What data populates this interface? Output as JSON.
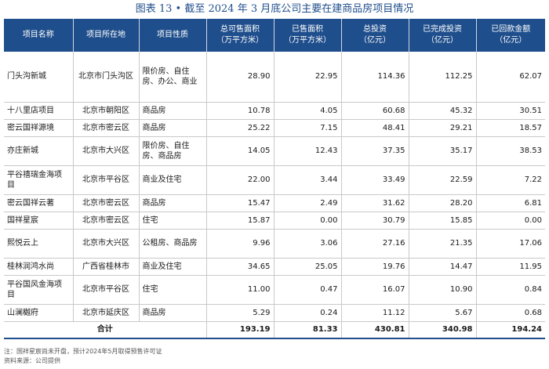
{
  "title": "图表 13 • 截至 2024 年 3 月底公司主要在建商品房项目情况",
  "headers": {
    "name": "项目名称",
    "location": "项目所在地",
    "nature": "项目性质",
    "saleable_area": "总可售面积\n（万平方米）",
    "sold_area": "已售面积\n（万平方米）",
    "total_investment": "总投资\n（亿元）",
    "completed_investment": "已完成投资\n（亿元）",
    "collected": "已回款金额\n（亿元）"
  },
  "rows": [
    {
      "name": "门头沟新城",
      "location": "北京市门头沟区",
      "nature": "限价房、自住房、办公、商业",
      "saleable_area": "28.90",
      "sold_area": "22.95",
      "total_investment": "114.36",
      "completed_investment": "112.25",
      "collected": "62.07"
    },
    {
      "name": "十八里店项目",
      "location": "北京市朝阳区",
      "nature": "商品房",
      "saleable_area": "10.78",
      "sold_area": "4.05",
      "total_investment": "60.68",
      "completed_investment": "45.32",
      "collected": "30.51"
    },
    {
      "name": "密云国祥源境",
      "location": "北京市密云区",
      "nature": "商品房",
      "saleable_area": "25.22",
      "sold_area": "7.15",
      "total_investment": "48.41",
      "completed_investment": "29.21",
      "collected": "18.57"
    },
    {
      "name": "亦庄新城",
      "location": "北京市大兴区",
      "nature": "限价房、自住房、商品房",
      "saleable_area": "14.05",
      "sold_area": "12.43",
      "total_investment": "37.35",
      "completed_investment": "35.17",
      "collected": "38.53"
    },
    {
      "name": "平谷禧瑞金海项目",
      "location": "北京市平谷区",
      "nature": "商业及住宅",
      "saleable_area": "22.00",
      "sold_area": "3.44",
      "total_investment": "33.49",
      "completed_investment": "22.59",
      "collected": "7.22"
    },
    {
      "name": "密云国祥云著",
      "location": "北京市密云区",
      "nature": "商品房",
      "saleable_area": "15.47",
      "sold_area": "2.49",
      "total_investment": "31.62",
      "completed_investment": "28.20",
      "collected": "6.81"
    },
    {
      "name": "国祥星宸",
      "location": "北京市密云区",
      "nature": "住宅",
      "saleable_area": "15.87",
      "sold_area": "0.00",
      "total_investment": "30.79",
      "completed_investment": "15.85",
      "collected": "0.00"
    },
    {
      "name": "熙悦云上",
      "location": "北京市大兴区",
      "nature": "公租房、商品房",
      "saleable_area": "9.96",
      "sold_area": "3.06",
      "total_investment": "27.16",
      "completed_investment": "21.35",
      "collected": "17.06"
    },
    {
      "name": "桂林润鸿水尚",
      "location": "广西省桂林市",
      "nature": "商业及住宅",
      "saleable_area": "34.65",
      "sold_area": "25.05",
      "total_investment": "19.76",
      "completed_investment": "14.47",
      "collected": "11.95"
    },
    {
      "name": "平谷国风金海项目",
      "location": "北京市平谷区",
      "nature": "住宅",
      "saleable_area": "11.00",
      "sold_area": "0.47",
      "total_investment": "16.07",
      "completed_investment": "10.90",
      "collected": "0.84"
    },
    {
      "name": "山澜樾府",
      "location": "北京市延庆区",
      "nature": "商品房",
      "saleable_area": "5.29",
      "sold_area": "0.24",
      "total_investment": "11.12",
      "completed_investment": "5.67",
      "collected": "0.68"
    }
  ],
  "total": {
    "label": "合计",
    "saleable_area": "193.19",
    "sold_area": "81.33",
    "total_investment": "430.81",
    "completed_investment": "340.98",
    "collected": "194.24"
  },
  "notes": [
    "注：国祥星宸尚未开盘，预计2024年5月取得预售许可证",
    "资料来源：公司提供"
  ],
  "colors": {
    "header_bg": "#1f4e8c",
    "header_text": "#ffffff",
    "title_text": "#1f4e8c"
  }
}
